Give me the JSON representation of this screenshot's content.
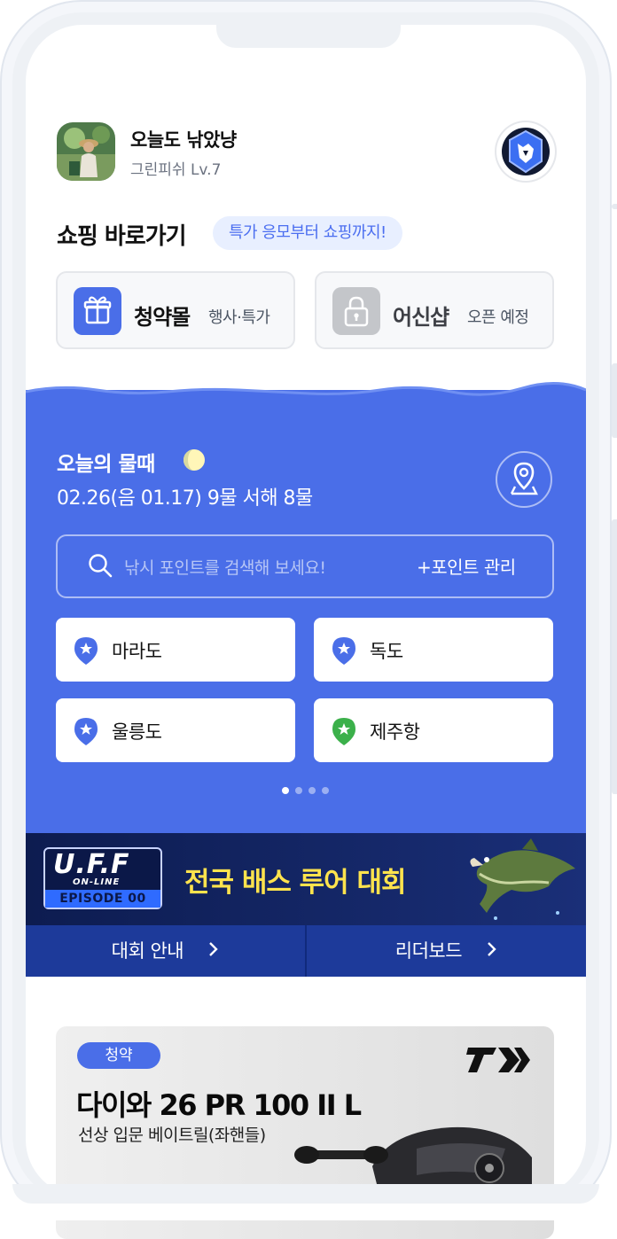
{
  "profile": {
    "nickname": "오늘도 낚았냥",
    "level": "그린피쉬 Lv.7"
  },
  "shopping": {
    "title": "쇼핑 바로가기",
    "pill": "특가 응모부터 쇼핑까지!",
    "cards": [
      {
        "name": "청약몰",
        "sub": "행사·특가",
        "icon": "gift-icon",
        "color": "#4a6ee8"
      },
      {
        "name": "어신샵",
        "sub": "오픈 예정",
        "icon": "lock-icon",
        "color": "#c4c6ca"
      }
    ]
  },
  "tide": {
    "title": "오늘의 물때",
    "info": "02.26(음 01.17)  9물 서해 8물",
    "search_placeholder": "낚시 포인트를 검색해 보세요!",
    "manage_label": "+포인트 관리",
    "points": [
      {
        "label": "마라도",
        "pin_color": "#4a6ee8"
      },
      {
        "label": "독도",
        "pin_color": "#4a6ee8"
      },
      {
        "label": "울릉도",
        "pin_color": "#4a6ee8"
      },
      {
        "label": "제주항",
        "pin_color": "#3bb04a"
      }
    ],
    "page_count": 4,
    "active_page": 1
  },
  "banner": {
    "logo": "U.F.F",
    "logo_sub": "ON-LINE",
    "episode": "EPISODE 00",
    "title": "전국 배스 루어 대회",
    "tabs": [
      {
        "label": "대회 안내"
      },
      {
        "label": "리더보드"
      }
    ]
  },
  "product": {
    "tag": "청약",
    "title": "다이와 26 PR 100 II L",
    "subtitle": "선상 입문 베이트릴(좌핸들)"
  },
  "colors": {
    "accent": "#4a6ee8",
    "banner_bg": "#12215a",
    "banner_title": "#ffe34d"
  }
}
